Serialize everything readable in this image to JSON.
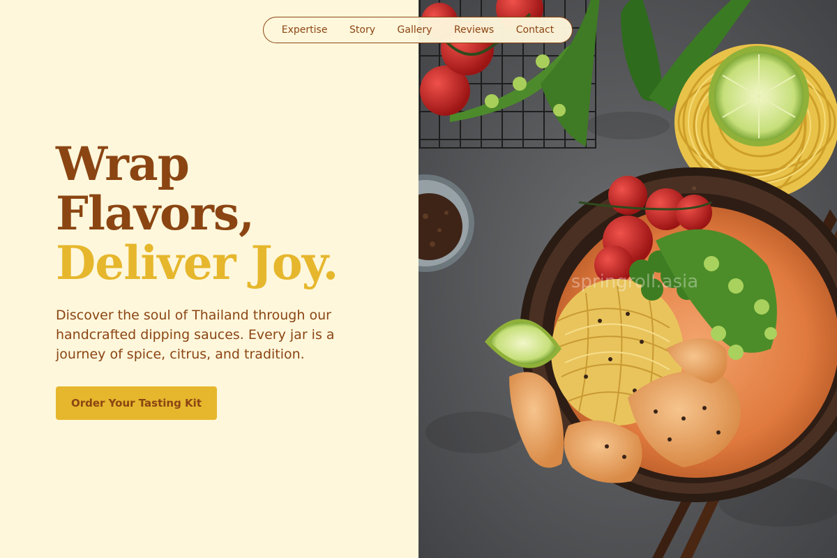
{
  "nav": {
    "items": [
      "Expertise",
      "Story",
      "Gallery",
      "Reviews",
      "Contact"
    ]
  },
  "hero": {
    "headline_line1": "Wrap",
    "headline_line2": "Flavors,",
    "headline_line3": "Deliver Joy.",
    "subtitle": "Discover the soul of Thailand through our handcrafted dipping sauces. Every jar is a journey of spice, citrus, and tradition.",
    "cta_label": "Order Your Tasting Kit"
  },
  "image": {
    "watermark": "springroll.asia"
  },
  "colors": {
    "background": "#fef7dc",
    "brown": "#8b4513",
    "gold": "#e6b72c"
  }
}
